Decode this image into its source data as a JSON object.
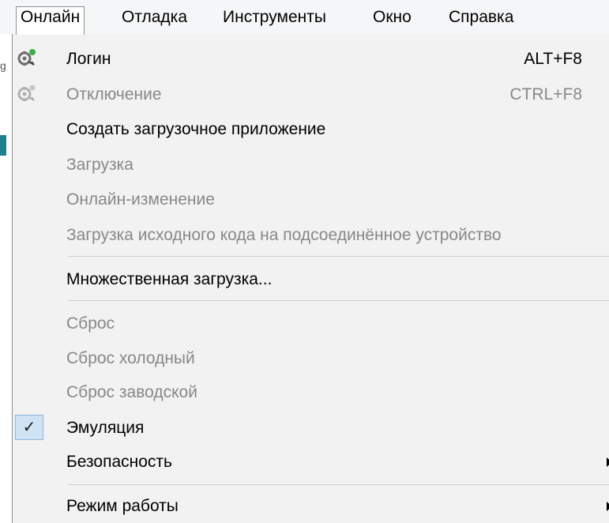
{
  "menubar": {
    "items": [
      {
        "label": "Онлайн",
        "active": true
      },
      {
        "label": "Отладка"
      },
      {
        "label": "Инструменты"
      },
      {
        "label": "Окно"
      },
      {
        "label": "Справка"
      }
    ]
  },
  "menu": {
    "items": [
      {
        "label": "Логин",
        "shortcut": "ALT+F8",
        "enabled": true,
        "icon": "login-icon"
      },
      {
        "label": "Отключение",
        "shortcut": "CTRL+F8",
        "enabled": false,
        "icon": "logout-icon"
      },
      {
        "label": "Создать загрузочное приложение",
        "enabled": true
      },
      {
        "label": "Загрузка",
        "enabled": false
      },
      {
        "label": "Онлайн-изменение",
        "enabled": false
      },
      {
        "label": "Загрузка исходного кода на подсоединённое устройство",
        "enabled": false
      },
      {
        "label": "Множественная загрузка...",
        "enabled": true
      },
      {
        "label": "Сброс",
        "enabled": false
      },
      {
        "label": "Сброс холодный",
        "enabled": false
      },
      {
        "label": "Сброс заводской",
        "enabled": false
      },
      {
        "label": "Эмуляция",
        "enabled": true,
        "checked": true,
        "check_glyph": "✓"
      },
      {
        "label": "Безопасность",
        "enabled": true,
        "submenu": true
      },
      {
        "label": "Режим работы",
        "enabled": true,
        "submenu": true
      }
    ]
  },
  "colors": {
    "enabled_text": "#000000",
    "disabled_text": "#888888",
    "check_highlight": "#cfe3f4",
    "login_icon_accent": "#3cb043"
  }
}
